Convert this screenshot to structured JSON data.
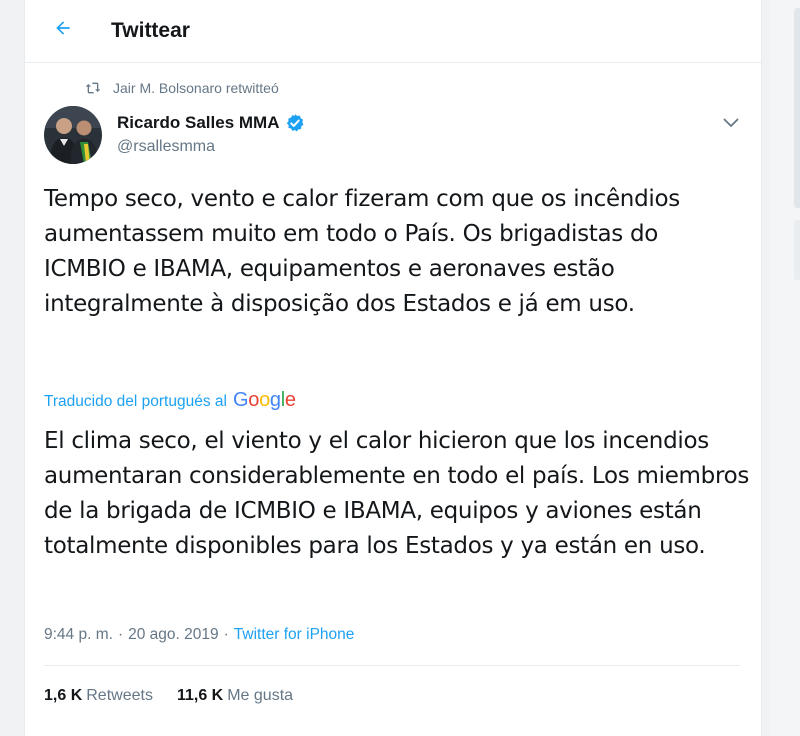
{
  "header": {
    "title": "Twittear",
    "back_icon": "arrow-left-icon"
  },
  "retweet": {
    "icon": "retweet-icon",
    "text": "Jair M. Bolsonaro retwitteó"
  },
  "author": {
    "name": "Ricardo Salles MMA",
    "handle": "@rsallesmma",
    "verified": true,
    "verified_icon": "verified-badge-icon"
  },
  "tweet": {
    "text": "Tempo seco, vento e calor fizeram com que os incêndios aumentassem muito em todo o País. Os brigadistas do ICMBIO e IBAMA, equipamentos e aeronaves estão integralmente à disposição dos Estados e já em uso."
  },
  "translation": {
    "label": "Traducido del portugués al",
    "provider": "Google",
    "text": "El clima seco, el viento y el calor hicieron que los incendios aumentaran considerablemente en todo el país. Los miembros de la brigada de ICMBIO e IBAMA, equipos y aviones están totalmente disponibles para los Estados y ya están en uso."
  },
  "meta": {
    "time": "9:44 p. m.",
    "separator": "·",
    "date": "20 ago. 2019",
    "source": "Twitter for iPhone"
  },
  "stats": {
    "retweets_count": "1,6 K",
    "retweets_label": "Retweets",
    "likes_count": "11,6 K",
    "likes_label": "Me gusta"
  },
  "colors": {
    "accent": "#1da1f2",
    "text_primary": "#14171a",
    "text_secondary": "#657786",
    "border": "#e6ecf0",
    "google_blue": "#4285f4",
    "google_red": "#ea4335",
    "google_yellow": "#fbbc05",
    "google_green": "#34a853"
  }
}
